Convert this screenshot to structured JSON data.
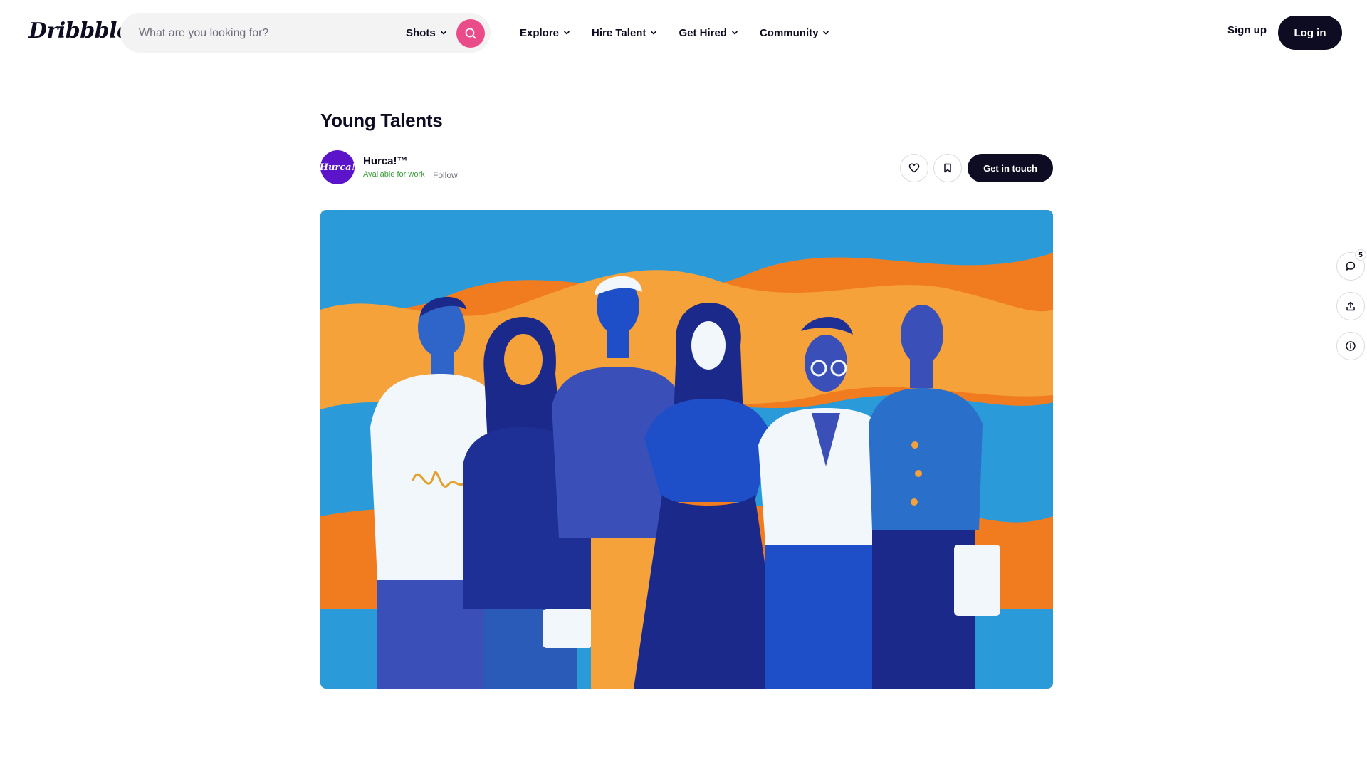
{
  "header": {
    "logo_text": "Dribbble",
    "search_placeholder": "What are you looking for?",
    "search_type": "Shots",
    "nav": [
      "Explore",
      "Hire Talent",
      "Get Hired",
      "Community"
    ],
    "signup_label": "Sign up",
    "login_label": "Log in"
  },
  "shot": {
    "title": "Young Talents",
    "author": {
      "name": "Hurca!™",
      "avatar_text": "Hurca!",
      "status": "Available for work",
      "follow_label": "Follow"
    },
    "contact_label": "Get in touch"
  },
  "sidebar": {
    "comment_count": "5"
  },
  "colors": {
    "brand_pink": "#ea4c89",
    "ink": "#0d0c22",
    "avatar_purple": "#5b14c9",
    "available_green": "#3a9c3a"
  },
  "icons": [
    "search-icon",
    "chevron-down-icon",
    "heart-icon",
    "bookmark-icon",
    "comment-icon",
    "share-icon",
    "info-icon"
  ]
}
